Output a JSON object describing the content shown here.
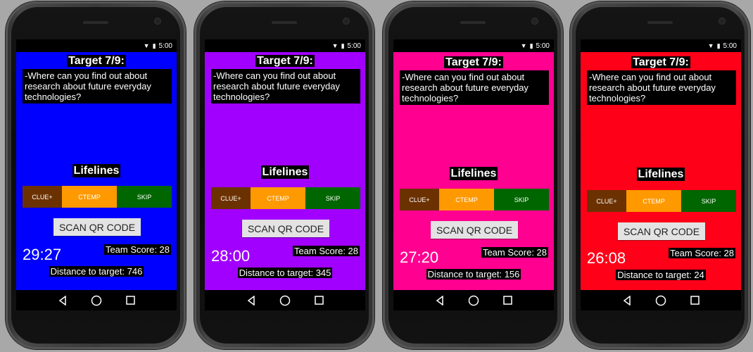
{
  "status": {
    "time": "5:00"
  },
  "target": {
    "title": "Target 7/9:",
    "question": "-Where can you find out about research about future everyday technologies?"
  },
  "lifelines": {
    "title": "Lifelines",
    "clue": "CLUE+",
    "ctemp": "CTEMP",
    "skip": "SKIP"
  },
  "scan_label": "SCAN QR CODE",
  "screens": [
    {
      "bg": "#0000ff",
      "timer": "29:27",
      "score": "Team Score: 28",
      "distance": "Distance to target: 746"
    },
    {
      "bg": "#a100ff",
      "timer": "28:00",
      "score": "Team Score: 28",
      "distance": "Distance to target: 345"
    },
    {
      "bg": "#ff0090",
      "timer": "27:20",
      "score": "Team Score: 28",
      "distance": "Distance to target: 156"
    },
    {
      "bg": "#ff0019",
      "timer": "26:08",
      "score": "Team Score: 28",
      "distance": "Distance to target: 24"
    }
  ],
  "icons": {
    "wifi": "wifi-icon",
    "battery": "battery-icon",
    "back": "back-icon",
    "home": "home-icon",
    "recents": "recents-icon"
  }
}
